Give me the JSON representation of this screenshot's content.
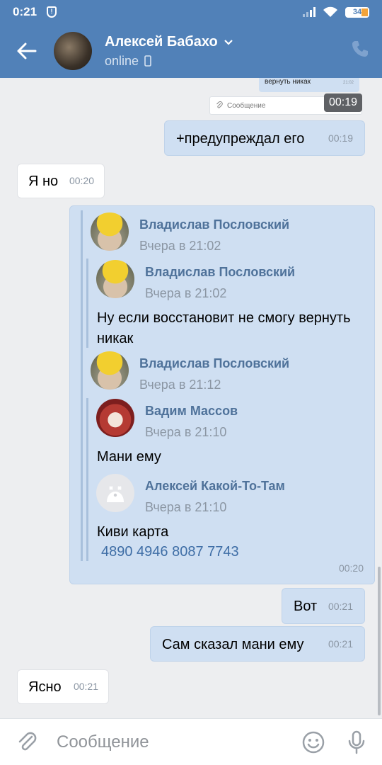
{
  "statusbar": {
    "time": "0:21",
    "battery": "34"
  },
  "header": {
    "name": "Алексей Бабахо",
    "status": "online"
  },
  "messages": {
    "shot": {
      "text": "вернуть никак",
      "time_small": "21:02",
      "input_placeholder": "Сообщение",
      "badge": "00:19"
    },
    "m1": {
      "text": "+предупреждал его",
      "time": "00:19"
    },
    "m2": {
      "text": "Я но",
      "time": "00:20"
    },
    "fwd": {
      "time": "00:20",
      "a1": {
        "name": "Владислав Пословский",
        "date": "Вчера в 21:02"
      },
      "a1n": {
        "name": "Владислав Пословский",
        "date": "Вчера в 21:02",
        "text": "Ну если восстановит не смогу вернуть никак"
      },
      "a2": {
        "name": "Владислав Пословский",
        "date": "Вчера в 21:12"
      },
      "a2n1": {
        "name": "Вадим Массов",
        "date": "Вчера в 21:10",
        "text": "Мани ему"
      },
      "a2n2": {
        "name": "Алексей Какой-То-Там",
        "date": "Вчера в 21:10",
        "text": "Киви карта",
        "card": "4890 4946 8087 7743"
      }
    },
    "m3": {
      "text": "Вот",
      "time": "00:21"
    },
    "m4": {
      "text": "Сам сказал мани ему",
      "time": "00:21"
    },
    "m5": {
      "text": "Ясно",
      "time": "00:21"
    }
  },
  "input": {
    "placeholder": "Сообщение"
  },
  "colors": {
    "header_bg": "#5181b8",
    "outgoing_bubble": "#cfdff2",
    "incoming_bubble": "#ffffff",
    "link": "#3f6ea6",
    "author": "#4f729a"
  }
}
